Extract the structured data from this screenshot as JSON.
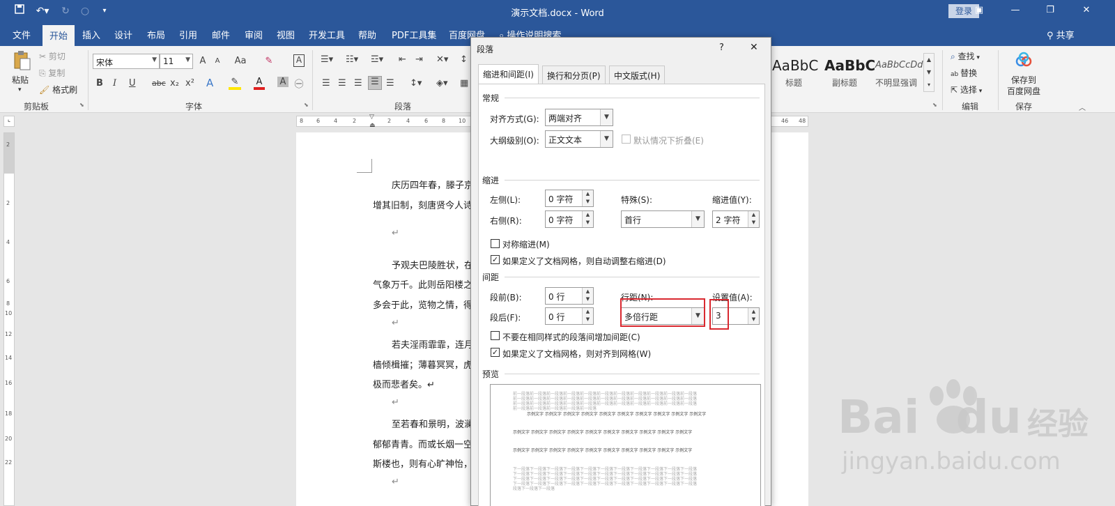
{
  "window": {
    "title": "演示文档.docx - Word",
    "login": "登录",
    "share": "共享",
    "help_search": "操作说明搜索"
  },
  "tabs": [
    "文件",
    "开始",
    "插入",
    "设计",
    "布局",
    "引用",
    "邮件",
    "审阅",
    "视图",
    "开发工具",
    "帮助",
    "PDF工具集",
    "百度网盘"
  ],
  "ribbon": {
    "clipboard": {
      "paste": "粘贴",
      "cut": "剪切",
      "copy": "复制",
      "format_painter": "格式刷",
      "group": "剪贴板"
    },
    "font": {
      "name": "宋体",
      "size": "11",
      "group": "字体",
      "bold": "B",
      "italic": "I",
      "underline": "U",
      "strike": "abc",
      "sub": "x₂",
      "sup": "x²",
      "aa": "Aa",
      "grow": "A",
      "shrink": "A"
    },
    "paragraph": {
      "group": "段落"
    },
    "styles": [
      {
        "preview": "AaBbC",
        "label": "标题"
      },
      {
        "preview": "AaBbC",
        "label": "副标题"
      },
      {
        "preview": "AaBbCcDd",
        "label": "不明显强调"
      }
    ],
    "editing": {
      "find": "查找",
      "replace": "替换",
      "select": "选择",
      "group": "编辑"
    },
    "save": {
      "label1": "保存到",
      "label2": "百度网盘",
      "group": "保存"
    }
  },
  "ruler": {
    "h_left": [
      "8",
      "6",
      "4",
      "2",
      "",
      "2",
      "4",
      "6",
      "8",
      "10"
    ],
    "h_right": [
      "46",
      "48"
    ],
    "v": [
      "2",
      "",
      "2",
      "",
      "4",
      "",
      "6",
      "",
      "8",
      "",
      "10",
      "12",
      "14",
      "16",
      "18",
      "20",
      "22"
    ]
  },
  "document": {
    "lines": [
      "庆历四年春，滕子京",
      "增其旧制，刻唐贤今人诗",
      "↵",
      "予观夫巴陵胜状，在",
      "气象万千。此则岳阳楼之",
      "多会于此，览物之情，得",
      "↵",
      "若夫淫雨霏霏，连月",
      "樯倾楫摧；薄暮冥冥，虎",
      "极而悲者矣。↵",
      "↵",
      "至若春和景明，波澜",
      "郁郁青青。而或长烟一空",
      "斯楼也，则有心旷神怡，",
      "↵"
    ]
  },
  "dialog": {
    "title": "段落",
    "help": "?",
    "close": "✕",
    "tabs": [
      "缩进和间距(I)",
      "换行和分页(P)",
      "中文版式(H)"
    ],
    "general": {
      "section": "常规",
      "align_label": "对齐方式(G):",
      "align_value": "两端对齐",
      "outline_label": "大纲级别(O):",
      "outline_value": "正文文本",
      "collapse_label": "默认情况下折叠(E)"
    },
    "indent": {
      "section": "缩进",
      "left_label": "左侧(L):",
      "left_value": "0 字符",
      "right_label": "右侧(R):",
      "right_value": "0 字符",
      "special_label": "特殊(S):",
      "special_value": "首行",
      "by_label": "缩进值(Y):",
      "by_value": "2 字符",
      "mirror": "对称缩进(M)",
      "auto_adjust": "如果定义了文档网格，则自动调整右缩进(D)"
    },
    "spacing": {
      "section": "间距",
      "before_label": "段前(B):",
      "before_value": "0 行",
      "after_label": "段后(F):",
      "after_value": "0 行",
      "line_label": "行距(N):",
      "line_value": "多倍行距",
      "at_label": "设置值(A):",
      "at_value": "3",
      "no_space": "不要在相同样式的段落间增加间距(C)",
      "snap_grid": "如果定义了文档网格，则对齐到网格(W)"
    },
    "preview": {
      "section": "预览",
      "prev_line": "前一段落前一段落前一段落前一段落前一段落前一段落前一段落前一段落前一段落前一段落前一段落",
      "prev_short": "前一段落前一段落前一段落前一段落前一段落",
      "sample": "示例文字 示例文字 示例文字 示例文字 示例文字 示例文字 示例文字 示例文字 示例文字 示例文字",
      "sample_last": "示例文字 示例文字 示例文字 示例文字 示例文字 示例文字 示例文字 示例文字 示例文字 示例文字",
      "sample_end": "示例文字 示例文字 示例文字 示例文字 示例文字 示例文字 示例文字 示例文字 示例文字 示例文字",
      "next_line": "下一段落下一段落下一段落下一段落下一段落下一段落下一段落下一段落下一段落下一段落下一段落",
      "next_short": "段落下一段落下一段落"
    }
  },
  "watermark": {
    "logo": "Bai",
    "logo2": "du",
    "cn": "经验",
    "url": "jingyan.baidu.com"
  },
  "colors": {
    "word_blue": "#2b579a",
    "highlight_red": "#d9282f"
  }
}
